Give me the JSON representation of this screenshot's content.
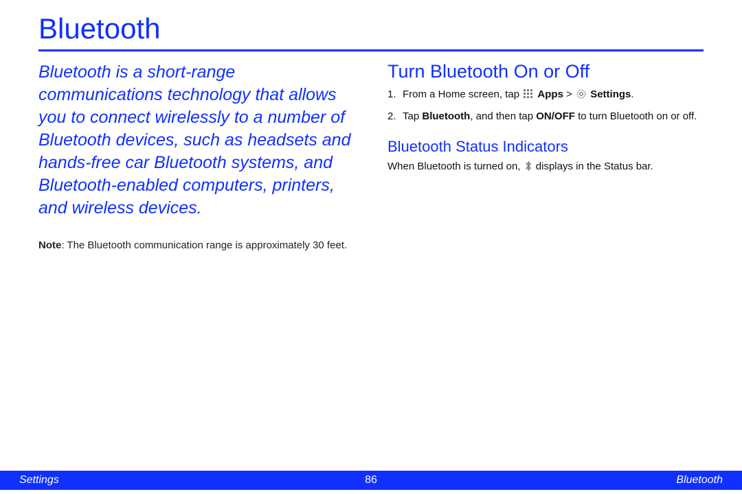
{
  "title": "Bluetooth",
  "intro": "Bluetooth is a short-range communications technology that allows you to connect wirelessly to a number of Bluetooth devices, such as headsets and hands-free car Bluetooth systems, and Bluetooth-enabled computers, printers, and wireless devices.",
  "note_label": "Note",
  "note_text": ": The Bluetooth communication range is approximately 30 feet.",
  "section1_heading": "Turn Bluetooth On or Off",
  "step1_num": "1.",
  "step1_a": "From a Home screen, tap ",
  "step1_apps": "Apps",
  "step1_gt": " > ",
  "step1_settings": "Settings",
  "step1_end": ".",
  "step2_num": "2.",
  "step2_a": "Tap ",
  "step2_b": "Bluetooth",
  "step2_c": ", and then tap ",
  "step2_d": "ON/OFF",
  "step2_e": " to turn Bluetooth on or off.",
  "section2_heading": "Bluetooth Status Indicators",
  "status_a": "When Bluetooth is turned on, ",
  "status_b": " displays in the Status bar.",
  "footer": {
    "left": "Settings",
    "page": "86",
    "right": "Bluetooth"
  }
}
